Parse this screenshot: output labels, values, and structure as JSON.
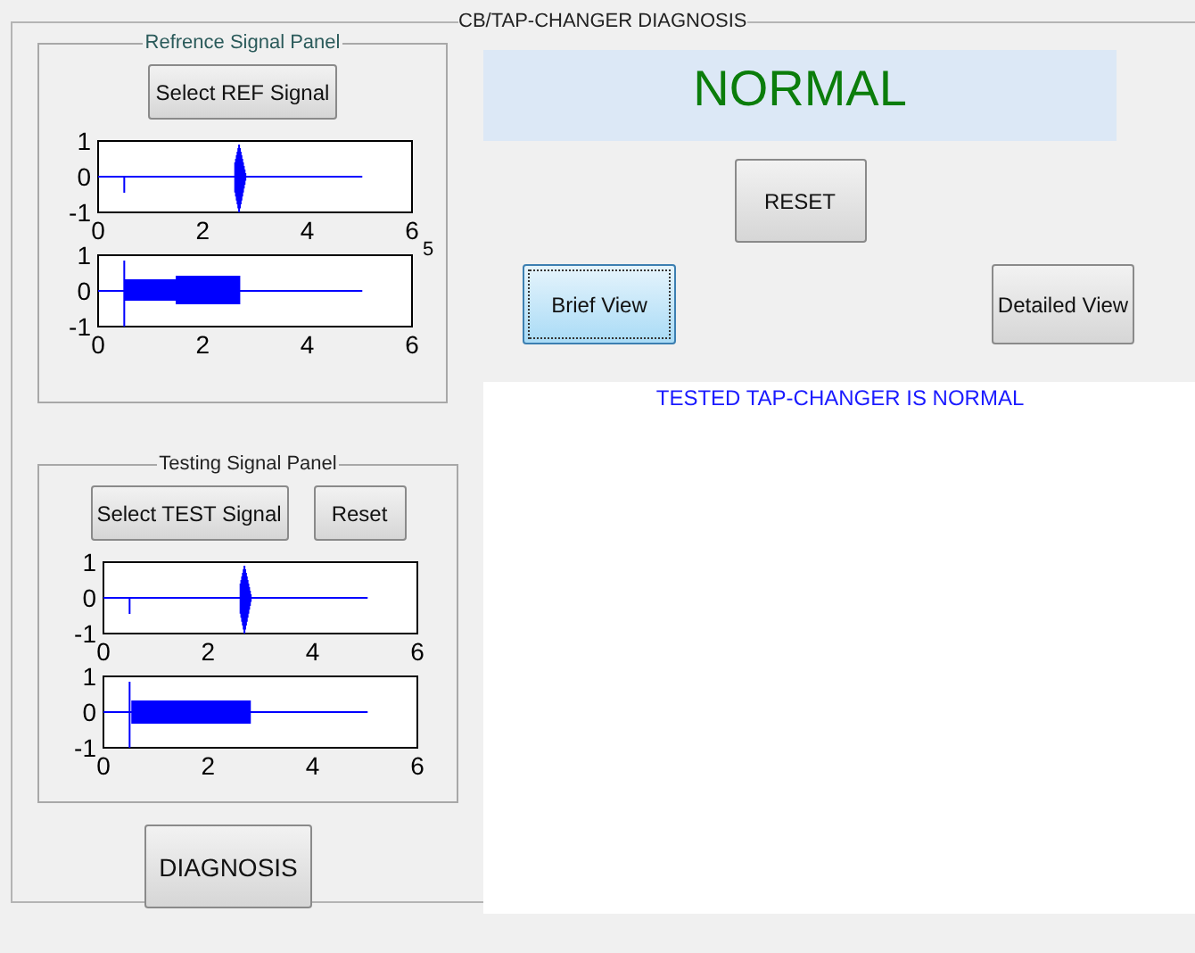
{
  "frame": {
    "title": "CB/TAP-CHANGER DIAGNOSIS"
  },
  "reference_panel": {
    "title": "Refrence Signal Panel",
    "buttons": [
      {
        "label": "Select REF Signal"
      }
    ],
    "plots": [
      {
        "kind": "spike",
        "yticks": [
          "1",
          "0",
          "-1"
        ],
        "xticks": [
          "0",
          "2",
          "4",
          "6"
        ],
        "x_exponent": "5"
      },
      {
        "kind": "dense",
        "yticks": [
          "1",
          "0",
          "-1"
        ],
        "xticks": [
          "0",
          "2",
          "4",
          "6"
        ]
      }
    ]
  },
  "testing_panel": {
    "title": "Testing Signal Panel",
    "buttons": [
      {
        "label": "Select TEST Signal"
      },
      {
        "label": "Reset"
      }
    ],
    "plots": [
      {
        "kind": "spike",
        "yticks": [
          "1",
          "0",
          "-1"
        ],
        "xticks": [
          "0",
          "2",
          "4",
          "6"
        ]
      },
      {
        "kind": "block",
        "yticks": [
          "1",
          "0",
          "-1"
        ],
        "xticks": [
          "0",
          "2",
          "4",
          "6"
        ]
      }
    ]
  },
  "diagnosis_button": {
    "label": "DIAGNOSIS"
  },
  "status_banner": {
    "text": "NORMAL"
  },
  "reset_button": {
    "label": "RESET"
  },
  "view_buttons": [
    {
      "label": "Brief View",
      "selected": true
    },
    {
      "label": "Detailed View",
      "selected": false
    }
  ],
  "result_area": {
    "text": "TESTED TAP-CHANGER IS NORMAL"
  }
}
